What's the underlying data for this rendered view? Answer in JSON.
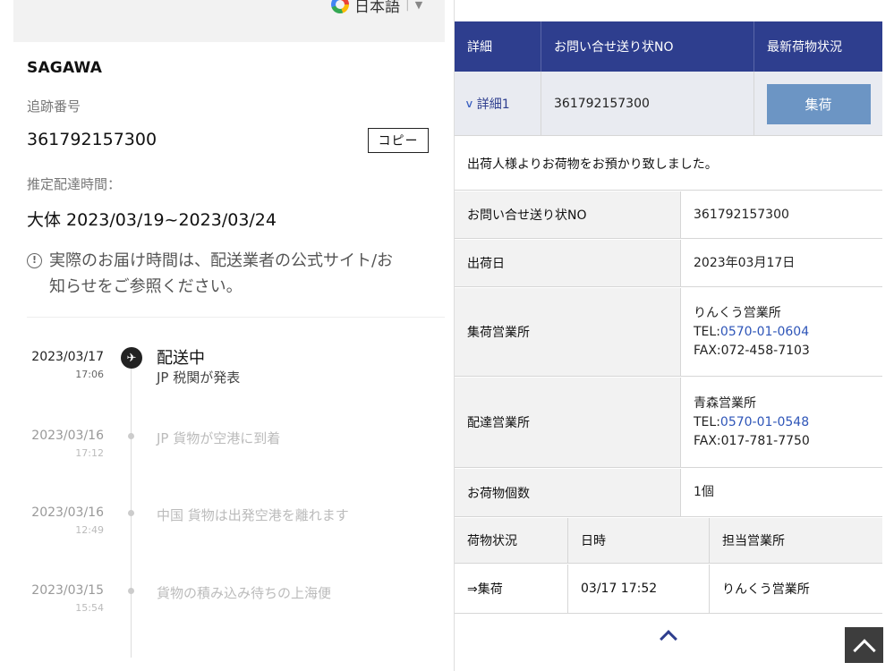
{
  "left": {
    "language": "日本語",
    "carrier": "SAGAWA",
    "tracking_label": "追跡番号",
    "tracking_number": "361792157300",
    "copy_button": "コピー",
    "eta_label": "推定配達時間：",
    "eta_value": "大体 2023/03/19~2023/03/24",
    "notice_line1": "実際のお届け時間は、配送業者の公式サイト/お",
    "notice_line2": "知らせをご参照ください。",
    "timeline": [
      {
        "date": "2023/03/17",
        "time": "17:06",
        "status": "配送中",
        "text": "JP 税関が発表"
      },
      {
        "date": "2023/03/16",
        "time": "17:12",
        "text": "JP 貨物が空港に到着"
      },
      {
        "date": "2023/03/16",
        "time": "12:49",
        "text": "中国 貨物は出発空港を離れます"
      },
      {
        "date": "2023/03/15",
        "time": "15:54",
        "text": "貨物の積み込み待ちの上海便"
      }
    ]
  },
  "right": {
    "header": {
      "detail": "詳細",
      "inquiry_no": "お問い合せ送り状NO",
      "latest_status": "最新荷物状況"
    },
    "detail_row": {
      "link": "詳細1",
      "number": "361792157300",
      "status_button": "集荷"
    },
    "message": "出荷人様よりお荷物をお預かり致しました。",
    "info": {
      "inquiry_label": "お問い合せ送り状NO",
      "inquiry_value": "361792157300",
      "ship_date_label": "出荷日",
      "ship_date_value": "2023年03月17日",
      "pickup_office_label": "集荷営業所",
      "pickup_office_name": "りんくう営業所",
      "pickup_tel_prefix": "TEL:",
      "pickup_tel": "0570-01-0604",
      "pickup_fax": "FAX:072-458-7103",
      "delivery_office_label": "配達営業所",
      "delivery_office_name": "青森営業所",
      "delivery_tel_prefix": "TEL:",
      "delivery_tel": "0570-01-0548",
      "delivery_fax": "FAX:017-781-7750",
      "count_label": "お荷物個数",
      "count_value": "1個"
    },
    "history": {
      "headers": [
        "荷物状況",
        "日時",
        "担当営業所"
      ],
      "row": [
        "⇒集荷",
        "03/17 17:52",
        "りんくう営業所"
      ]
    }
  }
}
